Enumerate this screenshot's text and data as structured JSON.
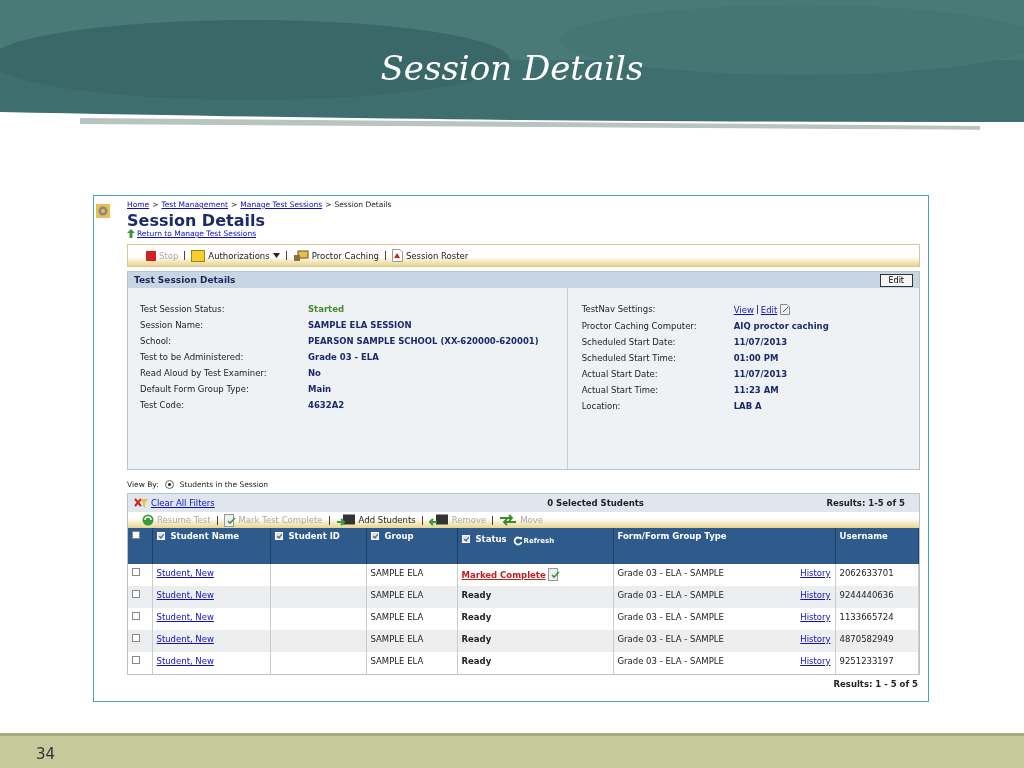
{
  "slide": {
    "title": "Session Details",
    "page_number": "34"
  },
  "breadcrumb": [
    {
      "label": "Home",
      "link": true,
      "separator": ">"
    },
    {
      "label": "Test Management",
      "link": true,
      "separator": ">"
    },
    {
      "label": "Manage Test Sessions",
      "link": true,
      "separator": ">"
    },
    {
      "label": "Session Details",
      "link": false
    }
  ],
  "page_title": "Session Details",
  "return_link": "Return to Manage Test Sessions",
  "toolbar": [
    {
      "label": "Stop",
      "kind": "stop",
      "disabled": true
    },
    {
      "label": "Authorizations",
      "kind": "folder",
      "disabled": false,
      "dropdown": true
    },
    {
      "label": "Proctor Caching",
      "kind": "caching",
      "disabled": false,
      "dropdown": false
    },
    {
      "label": "Session Roster",
      "kind": "pdf",
      "disabled": false,
      "dropdown": false
    }
  ],
  "details": {
    "title": "Test Session Details",
    "edit_button": "Edit",
    "left": [
      {
        "label": "Test Session Status:",
        "value": "Started",
        "kind": "status"
      },
      {
        "label": "Session Name:",
        "value": "SAMPLE ELA SESSION",
        "kind": "text"
      },
      {
        "label": "School:",
        "value": "PEARSON SAMPLE SCHOOL (XX-620000-620001)",
        "kind": "text"
      },
      {
        "label": "Test to be Administered:",
        "value": "Grade 03 - ELA",
        "kind": "text"
      },
      {
        "label": "Read Aloud by Test Examiner:",
        "value": "No",
        "kind": "text"
      },
      {
        "label": "Default Form Group Type:",
        "value": "Main",
        "kind": "text"
      },
      {
        "label": "Test Code:",
        "value": "4632A2",
        "kind": "text"
      }
    ],
    "right": [
      {
        "label": "TestNav Settings:",
        "kind": "links",
        "links": [
          "View",
          "Edit"
        ]
      },
      {
        "label": "Proctor Caching Computer:",
        "value": "AIQ proctor caching",
        "kind": "text"
      },
      {
        "label": "Scheduled Start Date:",
        "value": "11/07/2013",
        "kind": "text"
      },
      {
        "label": "Scheduled Start Time:",
        "value": "01:00 PM",
        "kind": "text"
      },
      {
        "label": "Actual Start Date:",
        "value": "11/07/2013",
        "kind": "text"
      },
      {
        "label": "Actual Start Time:",
        "value": "11:23 AM",
        "kind": "text"
      },
      {
        "label": "Location:",
        "value": "LAB A",
        "kind": "text"
      }
    ]
  },
  "view_by": {
    "label": "View By:",
    "option": {
      "label": "Students in the Session",
      "selected": true
    }
  },
  "grid": {
    "select_all": false,
    "clear_filters": "Clear All Filters",
    "selected_count": "0 Selected Students",
    "results": "Results: 1-5 of 5",
    "actions": [
      {
        "label": "Resume Test",
        "kind": "resume",
        "disabled": true
      },
      {
        "label": "Mark Test Complete",
        "kind": "mark",
        "disabled": true
      },
      {
        "label": "Add Students",
        "kind": "add",
        "disabled": false
      },
      {
        "label": "Remove",
        "kind": "remove",
        "disabled": true
      },
      {
        "label": "Move",
        "kind": "move",
        "disabled": true
      }
    ],
    "columns": [
      {
        "label": "Student Name",
        "filter": true
      },
      {
        "label": "Student ID",
        "filter": true
      },
      {
        "label": "Group",
        "filter": true
      },
      {
        "label": "Status",
        "filter": true,
        "refresh": "Refresh"
      },
      {
        "label": "Form/Form Group Type",
        "filter": false
      },
      {
        "label": "Username",
        "filter": false
      }
    ],
    "rows": [
      {
        "selected": false,
        "student": "Student, New",
        "group": "SAMPLE ELA",
        "status": "Marked Complete",
        "kind": "marked",
        "form": "Grade 03 - ELA - SAMPLE",
        "history": "History",
        "username": "2062633701"
      },
      {
        "selected": false,
        "student": "Student, New",
        "group": "SAMPLE ELA",
        "status": "Ready",
        "kind": "ready",
        "form": "Grade 03 - ELA - SAMPLE",
        "history": "History",
        "username": "9244440636"
      },
      {
        "selected": false,
        "student": "Student, New",
        "group": "SAMPLE ELA",
        "status": "Ready",
        "kind": "ready",
        "form": "Grade 03 - ELA - SAMPLE",
        "history": "History",
        "username": "1133665724"
      },
      {
        "selected": false,
        "student": "Student, New",
        "group": "SAMPLE ELA",
        "status": "Ready",
        "kind": "ready",
        "form": "Grade 03 - ELA - SAMPLE",
        "history": "History",
        "username": "4870582949"
      },
      {
        "selected": false,
        "student": "Student, New",
        "group": "SAMPLE ELA",
        "status": "Ready",
        "kind": "ready",
        "form": "Grade 03 - ELA - SAMPLE",
        "history": "History",
        "username": "9251233197"
      }
    ],
    "footer_results": "Results:  1 - 5 of 5"
  }
}
